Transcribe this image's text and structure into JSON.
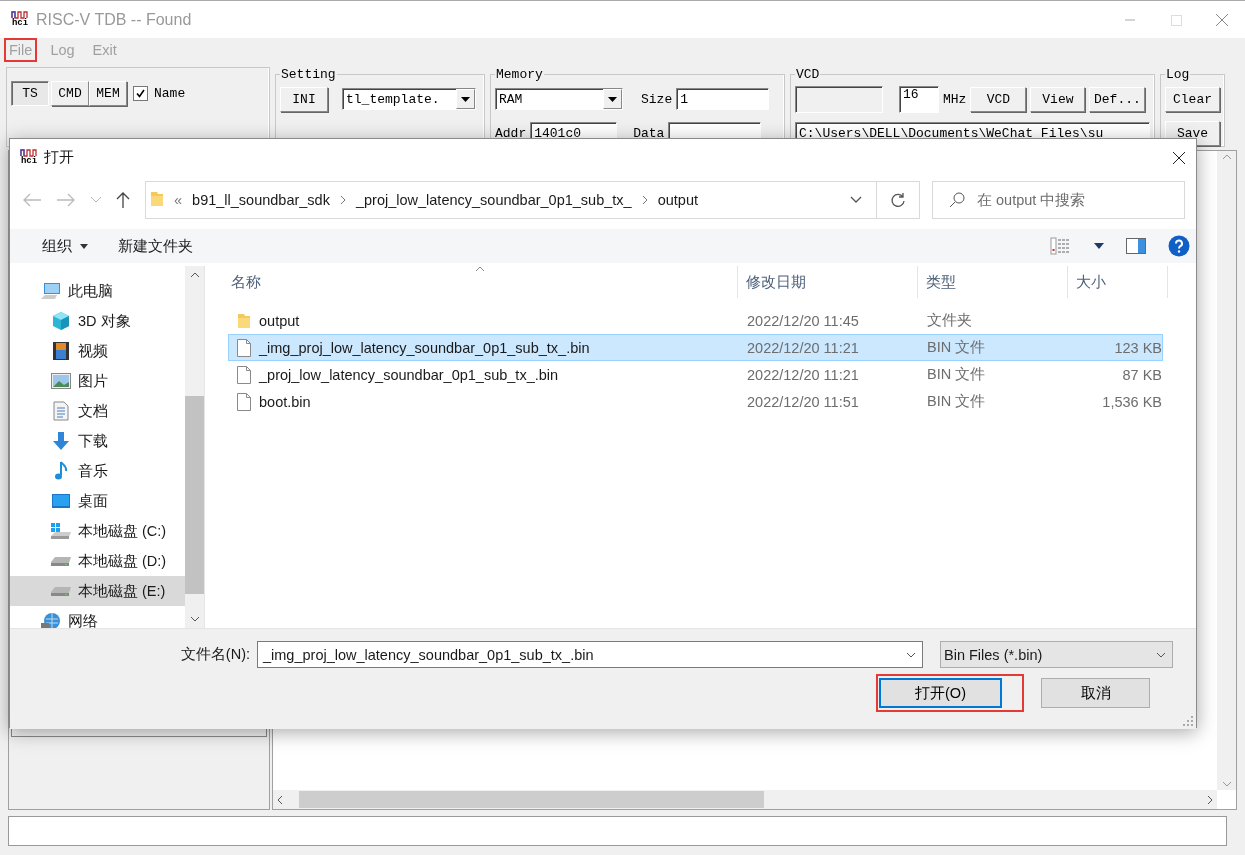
{
  "app": {
    "logo_text": "hci",
    "title": "RISC-V TDB -- Found",
    "menu": [
      {
        "label": "File",
        "highlighted": true
      },
      {
        "label": "Log",
        "highlighted": false
      },
      {
        "label": "Exit",
        "highlighted": false
      }
    ],
    "view_buttons": [
      {
        "label": "TS",
        "selected": true
      },
      {
        "label": "CMD",
        "selected": false
      },
      {
        "label": "MEM",
        "selected": false
      }
    ],
    "name_checkbox": {
      "label": "Name",
      "checked": true
    },
    "setting": {
      "title": "Setting",
      "ini_button": "INI",
      "template": "tl_template."
    },
    "memory": {
      "title": "Memory",
      "type": "RAM",
      "size_label": "Size",
      "size": "1",
      "addr_label": "Addr",
      "addr": "1401c0",
      "data_label": "Data"
    },
    "vcd": {
      "title": "VCD",
      "frequency": "16",
      "unit": "MHz",
      "buttons": [
        "VCD",
        "View",
        "Def..."
      ],
      "path": "C:\\Users\\DELL\\Documents\\WeChat Files\\su"
    },
    "log": {
      "title": "Log",
      "buttons": [
        "Clear",
        "Save"
      ]
    }
  },
  "dialog": {
    "logo_text": "hci",
    "title": "打开",
    "breadcrumb": {
      "overflow": "«",
      "items": [
        "b91_ll_soundbar_sdk",
        "_proj_low_latency_soundbar_0p1_sub_tx_",
        "output"
      ]
    },
    "search": {
      "placeholder": "在 output 中搜索"
    },
    "toolbar": {
      "organize": "组织",
      "new_folder": "新建文件夹"
    },
    "nav": [
      {
        "label": "此电脑",
        "kind": "computer",
        "selected": false,
        "children": [
          {
            "label": "3D 对象",
            "kind": "cube",
            "selected": false
          },
          {
            "label": "视频",
            "kind": "video",
            "selected": false
          },
          {
            "label": "图片",
            "kind": "pictures",
            "selected": false
          },
          {
            "label": "文档",
            "kind": "documents",
            "selected": false
          },
          {
            "label": "下载",
            "kind": "downloads",
            "selected": false
          },
          {
            "label": "音乐",
            "kind": "music",
            "selected": false
          },
          {
            "label": "桌面",
            "kind": "desktop",
            "selected": false
          },
          {
            "label": "本地磁盘 (C:)",
            "kind": "system-drive",
            "selected": false
          },
          {
            "label": "本地磁盘 (D:)",
            "kind": "drive",
            "selected": false
          },
          {
            "label": "本地磁盘 (E:)",
            "kind": "drive",
            "selected": true
          }
        ]
      },
      {
        "label": "网络",
        "kind": "network",
        "selected": false
      }
    ],
    "columns": [
      "名称",
      "修改日期",
      "类型",
      "大小"
    ],
    "rows": [
      {
        "kind": "folder",
        "name": "output",
        "date": "2022/12/20 11:45",
        "type": "文件夹",
        "size": "",
        "selected": false
      },
      {
        "kind": "file",
        "name": "_img_proj_low_latency_soundbar_0p1_sub_tx_.bin",
        "date": "2022/12/20 11:21",
        "type": "BIN 文件",
        "size": "123 KB",
        "selected": true
      },
      {
        "kind": "file",
        "name": "_proj_low_latency_soundbar_0p1_sub_tx_.bin",
        "date": "2022/12/20 11:21",
        "type": "BIN 文件",
        "size": "87 KB",
        "selected": false
      },
      {
        "kind": "file",
        "name": "boot.bin",
        "date": "2022/12/20 11:51",
        "type": "BIN 文件",
        "size": "1,536 KB",
        "selected": false
      }
    ],
    "filename_label": "文件名(N):",
    "filename": "_img_proj_low_latency_soundbar_0p1_sub_tx_.bin",
    "filter": "Bin Files (*.bin)",
    "buttons": [
      {
        "label": "打开(O)",
        "highlighted": true
      },
      {
        "label": "取消",
        "highlighted": false
      }
    ]
  }
}
